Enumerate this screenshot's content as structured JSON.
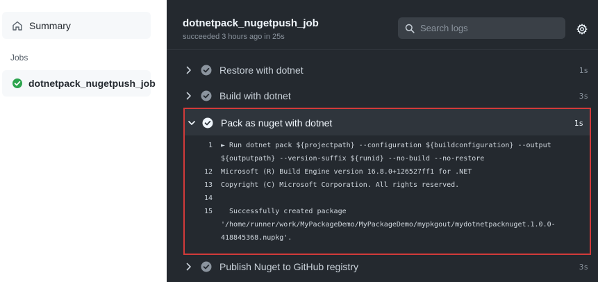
{
  "sidebar": {
    "summary_label": "Summary",
    "jobs_heading": "Jobs",
    "job_label": "dotnetpack_nugetpush_job"
  },
  "header": {
    "job_title": "dotnetpack_nugetpush_job",
    "status": "succeeded 3 hours ago in 25s",
    "search_placeholder": "Search logs"
  },
  "steps": [
    {
      "label": "Restore with dotnet",
      "duration": "1s"
    },
    {
      "label": "Build with dotnet",
      "duration": "3s"
    },
    {
      "label": "Pack as nuget with dotnet",
      "duration": "1s",
      "expanded": true
    },
    {
      "label": "Publish Nuget to GitHub registry",
      "duration": "3s"
    }
  ],
  "log": [
    {
      "line": "1",
      "text": "► Run dotnet pack ${projectpath} --configuration ${buildconfiguration} --output"
    },
    {
      "line": "",
      "text": "${outputpath} --version-suffix ${runid} --no-build --no-restore"
    },
    {
      "line": "12",
      "text": "Microsoft (R) Build Engine version 16.8.0+126527ff1 for .NET"
    },
    {
      "line": "13",
      "text": "Copyright (C) Microsoft Corporation. All rights reserved."
    },
    {
      "line": "14",
      "text": ""
    },
    {
      "line": "15",
      "text": "  Successfully created package"
    },
    {
      "line": "",
      "text": "'/home/runner/work/MyPackageDemo/MyPackageDemo/mypkgout/mydotnetpacknuget.1.0.0-"
    },
    {
      "line": "",
      "text": "418845368.nupkg'."
    }
  ],
  "colors": {
    "success": "#8b949e",
    "highlight_border": "#d23a3a",
    "job_success": "#2da44e"
  },
  "icons": {
    "summary": "home-icon",
    "job_status": "check-circle-icon",
    "search": "search-icon",
    "settings": "gear-icon",
    "step_status": "check-circle-icon",
    "collapsed": "chevron-right-icon",
    "expanded": "chevron-down-icon"
  }
}
